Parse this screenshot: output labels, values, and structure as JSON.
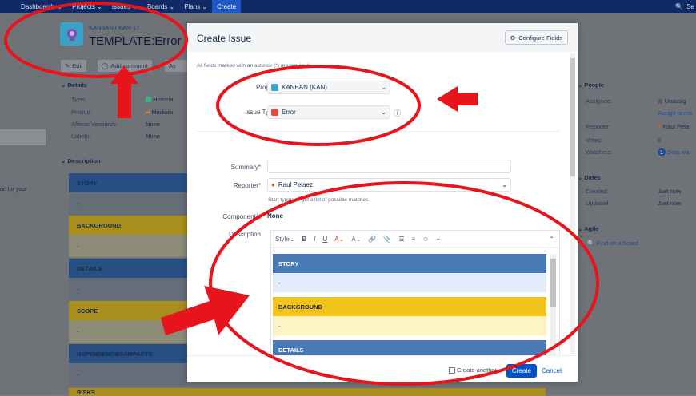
{
  "topbar": {
    "items": [
      "Dashboards ⌄",
      "Projects ⌄",
      "Issues ⌄",
      "Boards ⌄",
      "Plans ⌄"
    ],
    "create": "Create",
    "search": "Se"
  },
  "leftnav": {
    "text": "on for your"
  },
  "issue": {
    "breadcrumb_project": "KANBAN",
    "breadcrumb_key": "KAN-17",
    "title": "TEMPLATE:Error",
    "actions": {
      "edit": "Edit",
      "comment": "Add comment",
      "assign": "As"
    },
    "details": {
      "heading": "Details",
      "type_label": "Type:",
      "type_value": "Historia",
      "priority_label": "Priority:",
      "priority_value": "Medium",
      "affects_label": "Affects Version/s:",
      "affects_value": "None",
      "labels_label": "Labels:",
      "labels_value": "None"
    },
    "description_heading": "Description",
    "bands": [
      {
        "title": "STORY",
        "body": "-"
      },
      {
        "title": "BACKGROUND",
        "body": "-"
      },
      {
        "title": "DETAILS",
        "body": "-"
      },
      {
        "title": "SCOPE",
        "body": "-"
      },
      {
        "title": "DEPENDENCIES/IMPACTS",
        "body": "-"
      },
      {
        "title": "RISKS"
      }
    ],
    "people": {
      "heading": "People",
      "assignee_label": "Assignee:",
      "assignee_value": "Unassig",
      "assign_me": "Assign to me",
      "reporter_label": "Reporter:",
      "reporter_value": "Raul Pela",
      "votes_label": "Votes:",
      "votes_value": "0",
      "watchers_label": "Watchers:",
      "watchers_count": "1",
      "watchers_link": "Stop wa"
    },
    "dates": {
      "heading": "Dates",
      "created_label": "Created:",
      "created_value": "Just now",
      "updated_label": "Updated:",
      "updated_value": "Just now"
    },
    "agile": {
      "heading": "Agile",
      "link": "Find on a board"
    }
  },
  "modal": {
    "title": "Create Issue",
    "configure_fields": "Configure Fields",
    "required_note": "All fields marked with an asterisk (*) are required",
    "project_label": "Project",
    "project_value": "KANBAN (KAN)",
    "issue_type_label": "Issue Type",
    "issue_type_value": "Error",
    "summary_label": "Summary",
    "reporter_label": "Reporter",
    "reporter_value": "Raul Pelaez",
    "reporter_hint": "Start typing to get a list of possible matches.",
    "component_label": "Component/s",
    "component_value": "None",
    "description_label": "Description",
    "toolbar": {
      "style": "Style",
      "bold": "B",
      "italic": "I",
      "underline": "U",
      "color": "A",
      "more": "A",
      "link": "🔗",
      "attach": "📎",
      "bullet": "☰",
      "numbered": "≡",
      "emoji": "☺",
      "insert": "+"
    },
    "editor_sections": [
      {
        "title": "STORY",
        "body": "-"
      },
      {
        "title": "BACKGROUND",
        "body": "-"
      },
      {
        "title": "DETAILS",
        "body": "-"
      }
    ],
    "create_another": "Create another",
    "create_button": "Create",
    "cancel": "Cancel"
  },
  "colors": {
    "annotation": "#e8141c",
    "primary": "#0052cc",
    "story_blue": "#4a7ab5",
    "bg_yellow": "#f2c31a"
  }
}
